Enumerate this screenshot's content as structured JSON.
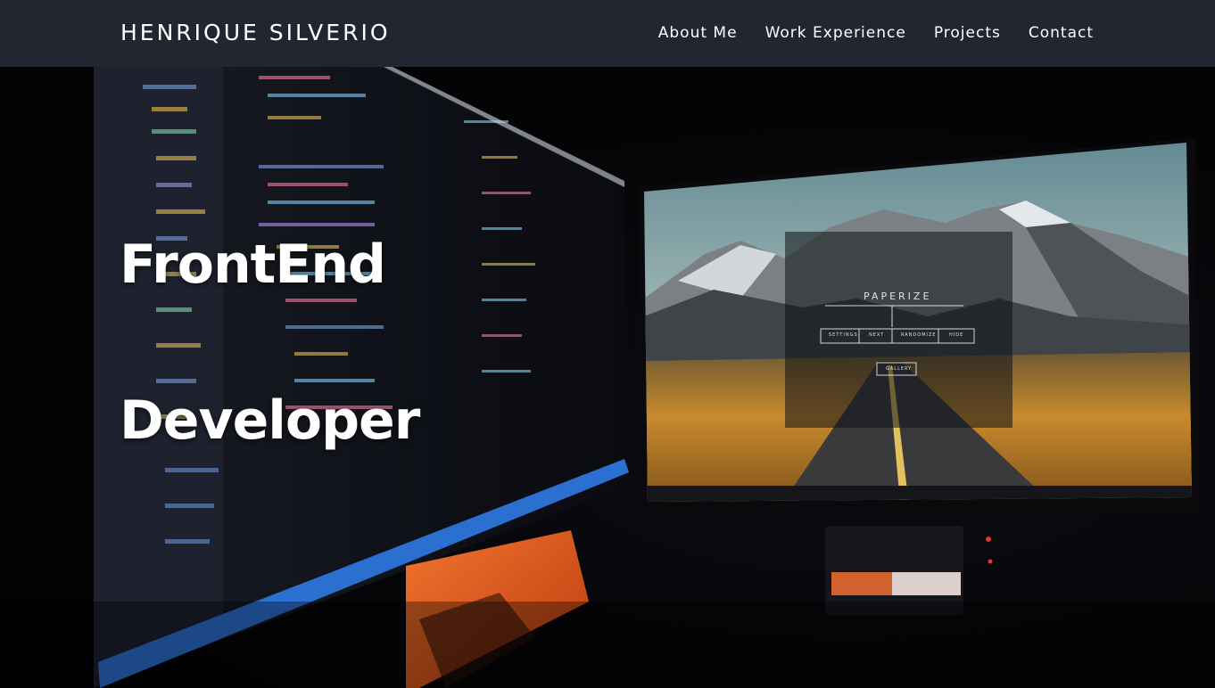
{
  "header": {
    "brand": "HENRIQUE SILVERIO",
    "nav": [
      {
        "label": "About Me"
      },
      {
        "label": "Work Experience"
      },
      {
        "label": "Projects"
      },
      {
        "label": "Contact"
      }
    ]
  },
  "hero": {
    "title_line1": "FrontEnd",
    "title_line2": "Developer",
    "screen_app_title": "PAPERIZE",
    "screen_buttons": [
      "SETTINGS",
      "NEXT",
      "RANDOMIZE",
      "HIDE"
    ],
    "screen_gallery_button": "GALLERY"
  },
  "colors": {
    "navbar_bg": "#222630",
    "text": "#ffffff",
    "accent_orange": "#e8672a"
  }
}
